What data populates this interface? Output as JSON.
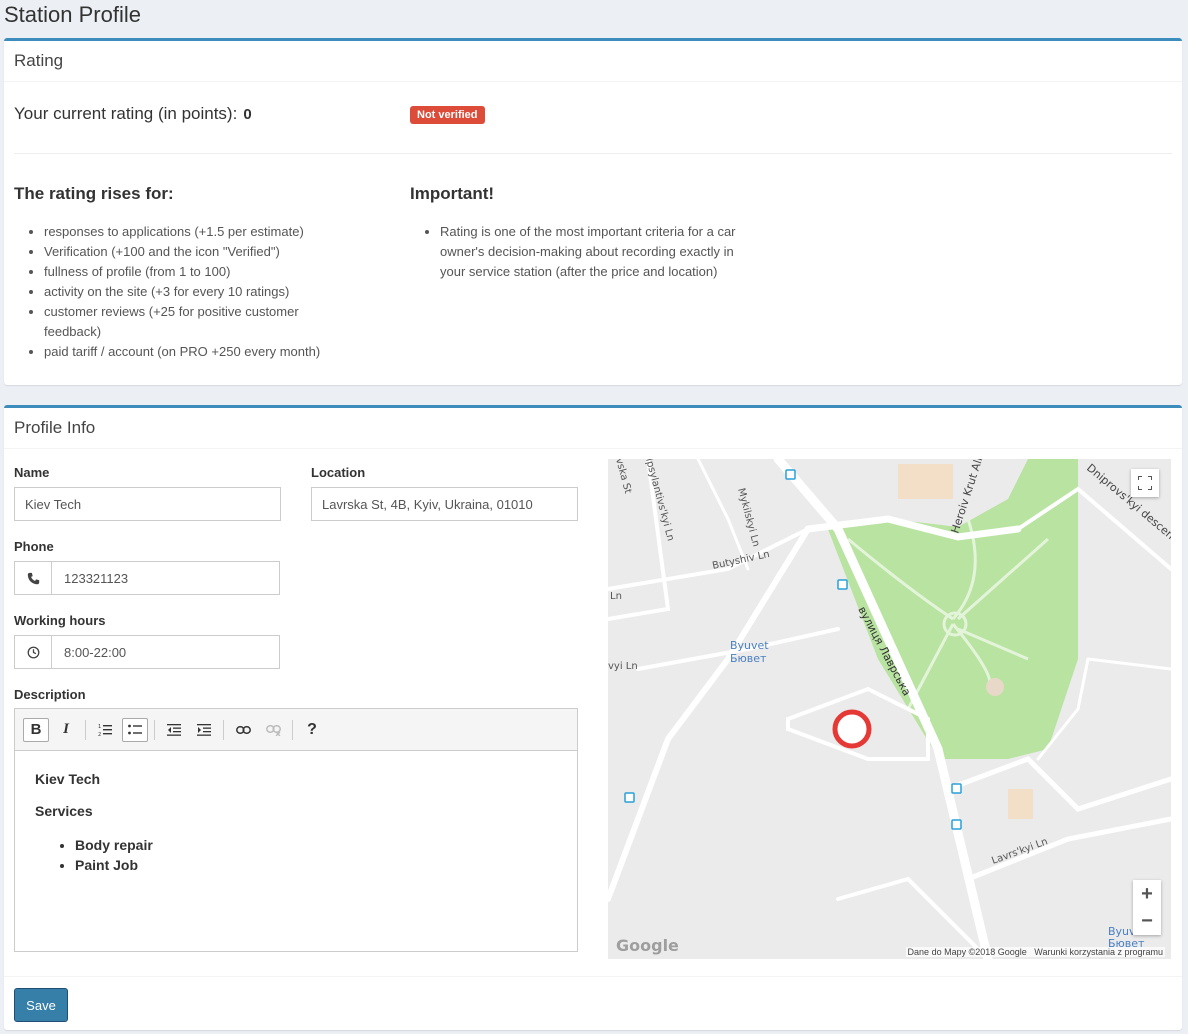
{
  "page": {
    "title": "Station Profile"
  },
  "rating": {
    "header": "Rating",
    "current_label": "Your current rating (in points):",
    "current_value": "0",
    "badge": "Not verified",
    "rises_title": "The rating rises for:",
    "rises_items": [
      "responses to applications (+1.5 per estimate)",
      "Verification (+100 and the icon \"Verified\")",
      "fullness of profile (from 1 to 100)",
      "activity on the site (+3 for every 10 ratings)",
      "customer reviews (+25 for positive customer feedback)",
      "paid tariff / account (on PRO +250 every month)"
    ],
    "important_title": "Important!",
    "important_items": [
      "Rating is one of the most important criteria for a car owner's decision-making about recording exactly in your service station (after the price and location)"
    ]
  },
  "profile": {
    "header": "Profile Info",
    "name_label": "Name",
    "name_value": "Kiev Tech",
    "location_label": "Location",
    "location_value": "Lavrska St, 4B, Kyiv, Ukraina, 01010",
    "phone_label": "Phone",
    "phone_value": "123321123",
    "hours_label": "Working hours",
    "hours_value": "8:00-22:00",
    "description_label": "Description",
    "description": {
      "title": "Kiev Tech",
      "subtitle": "Services",
      "items": [
        "Body repair",
        "Paint Job"
      ]
    },
    "toolbar": {
      "bold": "B",
      "italic": "I",
      "help": "?"
    },
    "save_label": "Save"
  },
  "map": {
    "labels": {
      "street_main": "вулиця Лаврська",
      "heroiv": "Heroiv Krut Alley",
      "dniprovskyi": "Dniprovs'kyi descent",
      "ipsylantivskyi": "Ipsylantivs'kyi Ln",
      "mykilskyi": "Mykilskyi Ln",
      "butyshiv": "Butyshiv Ln",
      "lavrskyi": "Lavrs'kyi Ln",
      "byuvet": "Byuvet",
      "byuvet_ua": "Бювет",
      "ln_left": "Ln",
      "vyi_ln": "vyi Ln",
      "ska_st": "vska St",
      "byuvet2": "Byuvet",
      "byuvet2_ua": "Бювет"
    },
    "attribution": "Dane do Mapy ©2018 Google",
    "terms": "Warunki korzystania z programu",
    "google_logo": "Google",
    "zoom_in": "+",
    "zoom_out": "−",
    "colors": {
      "park": "#b8e3a0",
      "road": "#ffffff",
      "bg": "#ebebeb",
      "marker": "#e53935"
    }
  }
}
